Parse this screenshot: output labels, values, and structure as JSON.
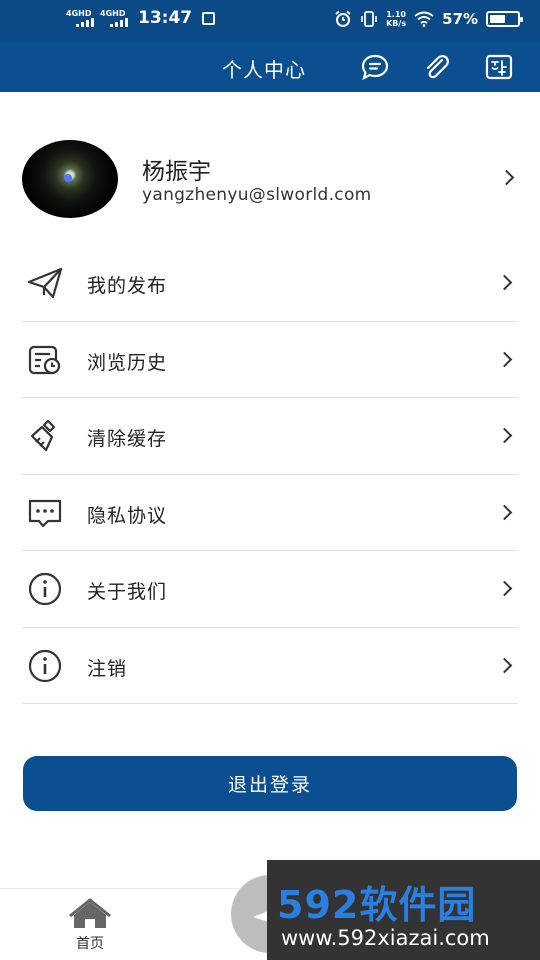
{
  "status_bar": {
    "sim1": "4GHD",
    "sim2": "4GHD",
    "time": "13:47",
    "speed_value": "1.10",
    "speed_unit": "KB/s",
    "battery_percent": "57%",
    "battery_level": 0.57
  },
  "header": {
    "title": "个人中心"
  },
  "profile": {
    "name": "杨振宇",
    "email": "yangzhenyu@slworld.com"
  },
  "menu": {
    "items": [
      {
        "label": "我的发布",
        "icon": "paper-plane-icon"
      },
      {
        "label": "浏览历史",
        "icon": "history-icon"
      },
      {
        "label": "清除缓存",
        "icon": "broom-icon"
      },
      {
        "label": "隐私协议",
        "icon": "message-dots-icon"
      },
      {
        "label": "关于我们",
        "icon": "info-icon"
      },
      {
        "label": "注销",
        "icon": "info-icon"
      }
    ]
  },
  "logout_label": "退出登录",
  "bottom_nav": {
    "home_label": "首页"
  },
  "watermark": {
    "brand": "592软件园",
    "url": "www.592xiazai.com"
  },
  "colors": {
    "primary": "#0b4f91",
    "status_bar": "#0b4a86"
  }
}
